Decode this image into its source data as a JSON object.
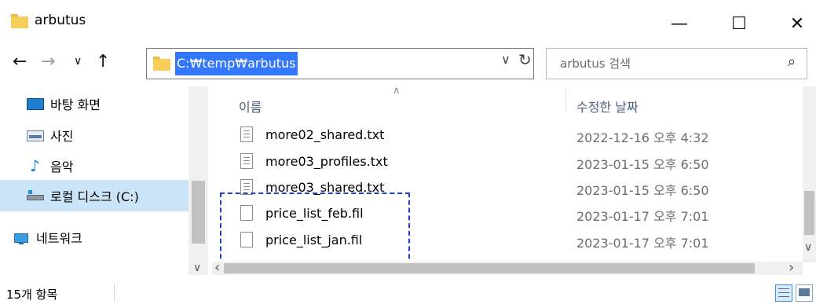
{
  "window": {
    "title": "arbutus",
    "minimize": "—",
    "maximize": "☐",
    "close": "✕"
  },
  "address": {
    "path": "C:₩temp₩arbutus",
    "dropdown": "∨",
    "refresh": "↻"
  },
  "nav_buttons": {
    "back": "←",
    "forward": "→",
    "recent": "∨",
    "up": "↑"
  },
  "search": {
    "placeholder": "arbutus 검색",
    "icon": "⌕"
  },
  "sidebar": {
    "items": [
      {
        "label": "바탕 화면",
        "icon": "desktop-icon"
      },
      {
        "label": "사진",
        "icon": "pictures-icon"
      },
      {
        "label": "음악",
        "icon": "music-icon"
      },
      {
        "label": "로컬 디스크 (C:)",
        "icon": "drive-icon",
        "selected": true
      },
      {
        "label": "네트워크",
        "icon": "network-icon"
      }
    ],
    "scroll_up": "∧",
    "scroll_down": "∨"
  },
  "columns": {
    "name": "이름",
    "date": "수정한 날짜",
    "sort_indicator": "∧"
  },
  "files": [
    {
      "name": "more02_shared.txt",
      "date": "2022-12-16 오후 4:32",
      "type": "txt"
    },
    {
      "name": "more03_profiles.txt",
      "date": "2023-01-15 오후 6:50",
      "type": "txt"
    },
    {
      "name": "more03_shared.txt",
      "date": "2023-01-15 오후 6:50",
      "type": "txt"
    },
    {
      "name": "price_list_feb.fil",
      "date": "2023-01-17 오후 7:01",
      "type": "fil"
    },
    {
      "name": "price_list_jan.fil",
      "date": "2023-01-17 오후 7:01",
      "type": "fil"
    }
  ],
  "scroll": {
    "left": "‹",
    "right": "›",
    "down": "∨"
  },
  "status": {
    "count": "15개 항목"
  },
  "colors": {
    "selection": "#3377ff",
    "nav_selected": "#cce4f7",
    "highlight_box": "#1a3fd6"
  }
}
